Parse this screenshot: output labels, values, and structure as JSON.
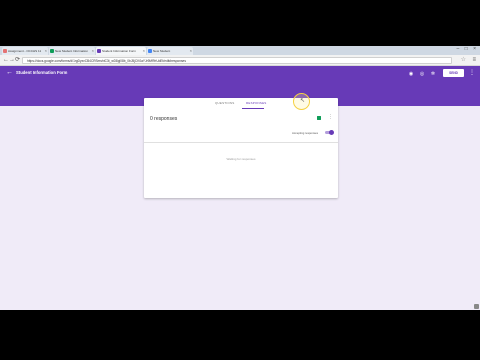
{
  "browser": {
    "tabs": [
      {
        "label": "Assignment - OCCHS 11",
        "favicon_color": "#e57373"
      },
      {
        "label": "New Student Information",
        "favicon_color": "#0f9d58"
      },
      {
        "label": "Student Information Form",
        "favicon_color": "#673ab7"
      },
      {
        "label": "New Student",
        "favicon_color": "#4285f4"
      }
    ],
    "window_controls": "– □ ×",
    "url": "https://docs.google.com/forms/d/1rgDyxvCB4CRSmshtC3t_wD8pj08b_0bJ5jCK0aYJr9MRfrUdEt/edit#responses",
    "nav": {
      "back": "←",
      "forward": "→",
      "reload": "⟳"
    },
    "star": "☆",
    "menu": "≡"
  },
  "header": {
    "title": "Student Information Form",
    "back_icon": "←",
    "icons": [
      "palette-icon",
      "preview-icon",
      "settings-icon"
    ],
    "send_label": "SEND",
    "more": "⋮"
  },
  "form": {
    "tabs": [
      {
        "label": "QUESTIONS",
        "selected": false
      },
      {
        "label": "RESPONSES",
        "selected": true
      }
    ],
    "responses_count_text": "0 responses",
    "accepting_label": "Accepting responses",
    "accepting": true,
    "empty_state": "Waiting for responses",
    "kebab": "⋮"
  },
  "colors": {
    "accent": "#673ab7",
    "background": "#f0ebf8",
    "sheets_green": "#0f9d58"
  }
}
